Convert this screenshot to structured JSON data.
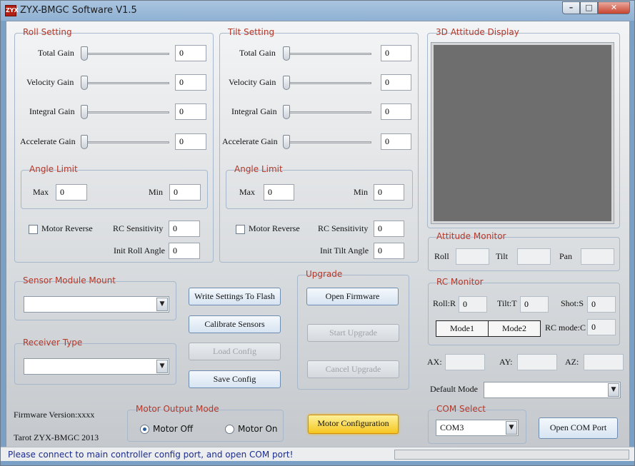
{
  "window": {
    "title": "ZYX-BMGC Software V1.5",
    "icon": "app-logo-icon",
    "controls": {
      "minimize": "minimize-icon",
      "maximize": "maximize-icon",
      "close": "close-icon"
    }
  },
  "roll": {
    "title": "Roll Setting",
    "gains": [
      {
        "label": "Total Gain",
        "value": "0"
      },
      {
        "label": "Velocity Gain",
        "value": "0"
      },
      {
        "label": "Integral Gain",
        "value": "0"
      },
      {
        "label": "Accelerate Gain",
        "value": "0"
      }
    ],
    "angle_limit": {
      "title": "Angle Limit",
      "max_label": "Max",
      "max": "0",
      "min_label": "Min",
      "min": "0"
    },
    "motor_reverse": "Motor Reverse",
    "rc_sensitivity_label": "RC Sensitivity",
    "rc_sensitivity": "0",
    "init_label": "Init Roll Angle",
    "init_value": "0"
  },
  "tilt": {
    "title": "Tilt Setting",
    "gains": [
      {
        "label": "Total Gain",
        "value": "0"
      },
      {
        "label": "Velocity Gain",
        "value": "0"
      },
      {
        "label": "Integral Gain",
        "value": "0"
      },
      {
        "label": "Accelerate Gain",
        "value": "0"
      }
    ],
    "angle_limit": {
      "title": "Angle Limit",
      "max_label": "Max",
      "max": "0",
      "min_label": "Min",
      "min": "0"
    },
    "motor_reverse": "Motor Reverse",
    "rc_sensitivity_label": "RC Sensitivity",
    "rc_sensitivity": "0",
    "init_label": "Init Tilt Angle",
    "init_value": "0"
  },
  "display": {
    "title": "3D Attitude Display"
  },
  "attitude": {
    "title": "Attitude Monitor",
    "roll": "Roll",
    "tilt": "Tilt",
    "pan": "Pan"
  },
  "rc": {
    "title": "RC Monitor",
    "roll_label": "Roll:R",
    "roll": "0",
    "tilt_label": "Tilt:T",
    "tilt": "0",
    "shot_label": "Shot:S",
    "shot": "0",
    "mode1": "Mode1",
    "mode2": "Mode2",
    "rcmode_label": "RC mode:C",
    "rcmode": "0"
  },
  "accel": {
    "ax": "AX:",
    "ay": "AY:",
    "az": "AZ:"
  },
  "default_mode": {
    "label": "Default Mode",
    "value": ""
  },
  "sensor": {
    "title": "Sensor Module Mount",
    "value": ""
  },
  "receiver": {
    "title": "Receiver Type",
    "value": ""
  },
  "buttons": {
    "write": "Write Settings To Flash",
    "calibrate": "Calibrate Sensors",
    "load": "Load Config",
    "save": "Save Config",
    "open_fw": "Open Firmware",
    "start_upgrade": "Start Upgrade",
    "cancel_upgrade": "Cancel Upgrade",
    "motor_config": "Motor Configuration",
    "open_com": "Open COM Port"
  },
  "upgrade": {
    "title": "Upgrade"
  },
  "firmware": {
    "version": "Firmware Version:xxxx",
    "copyright": "Tarot ZYX-BMGC 2013"
  },
  "motor_output": {
    "title": "Motor Output Mode",
    "off": "Motor Off",
    "on": "Motor On"
  },
  "com": {
    "title": "COM Select",
    "value": "COM3"
  },
  "status": {
    "text": "Please connect to main controller config port, and open COM port!"
  }
}
